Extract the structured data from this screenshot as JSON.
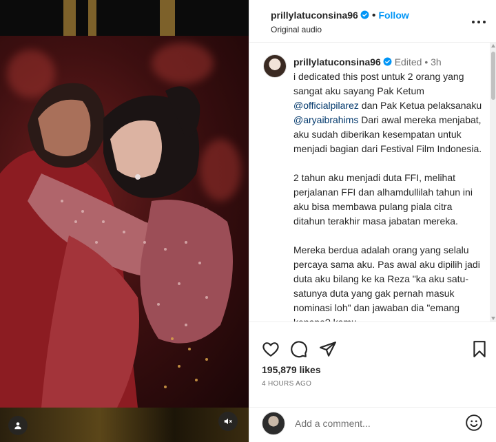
{
  "post": {
    "username": "prillylatuconsina96",
    "follow_label": "Follow",
    "audio_label": "Original audio",
    "separator": "•"
  },
  "caption": {
    "username": "prillylatuconsina96",
    "edited": "Edited",
    "separator": "•",
    "time_ago": "3h",
    "p1_a": "i dedicated this post untuk 2 orang yang sangat aku sayang Pak Ketum ",
    "mention1": "@officialpilarez",
    "p1_b": " dan Pak Ketua pelaksanaku ",
    "mention2": "@aryaibrahims",
    "p1_c": " Dari awal mereka menjabat, aku sudah diberikan kesempatan untuk menjadi bagian dari Festival Film Indonesia.",
    "p2": "2 tahun aku menjadi duta FFI, melihat perjalanan FFI dan alhamdullilah tahun ini aku bisa membawa pulang piala citra ditahun terakhir masa jabatan mereka.",
    "p3": "Mereka berdua adalah orang yang selalu percaya sama aku. Pas awal aku dipilih jadi duta aku bilang ke ka Reza \"ka aku satu-satunya duta yang gak pernah masuk nominasi loh\" dan jawaban dia \"emang kenapa? kamu"
  },
  "stats": {
    "likes": "195,879 likes",
    "timestamp": "4 HOURS AGO"
  },
  "comment_box": {
    "placeholder": "Add a comment..."
  },
  "icons": {
    "verified": "verified-badge-icon",
    "more": "more-options-icon",
    "like": "heart-icon",
    "comment": "comment-icon",
    "share": "share-icon",
    "save": "bookmark-icon",
    "emoji": "emoji-icon",
    "mute": "muted-speaker-icon",
    "tag": "user-tag-icon"
  },
  "colors": {
    "accent": "#0095f6",
    "verified": "#0095f6",
    "mention": "#00376b",
    "text": "#262626",
    "muted": "#737373"
  }
}
